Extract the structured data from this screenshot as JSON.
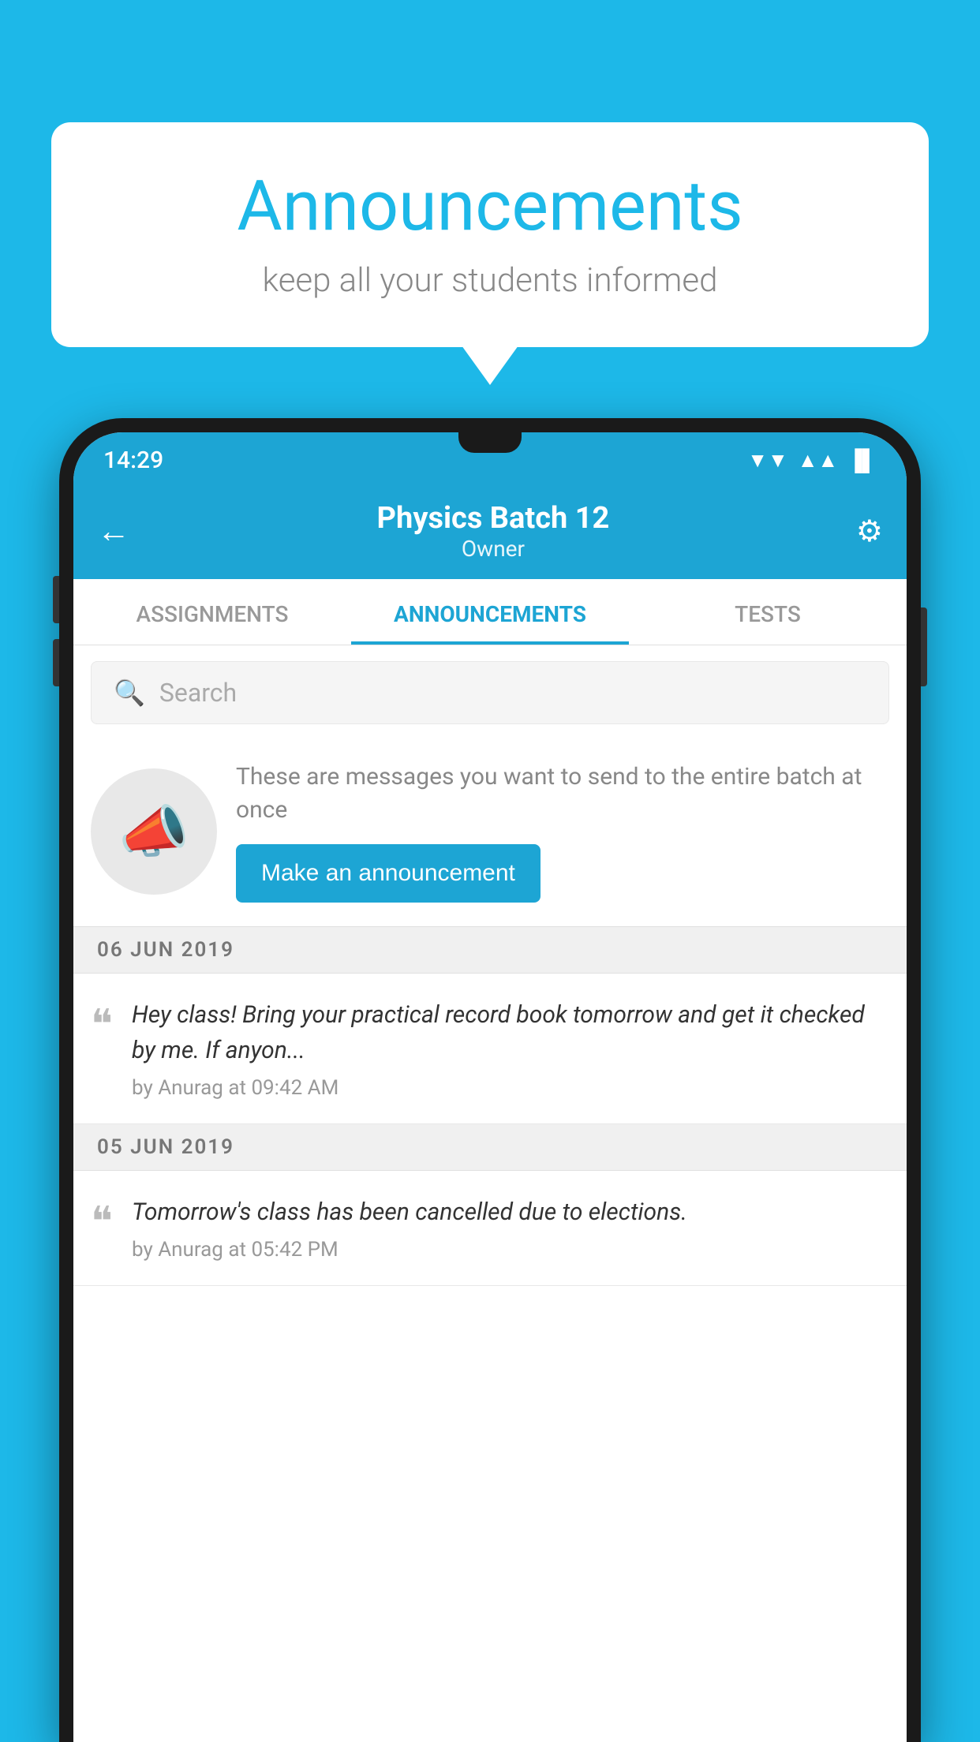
{
  "background_color": "#1DB8E8",
  "bubble": {
    "title": "Announcements",
    "subtitle": "keep all your students informed"
  },
  "phone": {
    "status_bar": {
      "time": "14:29",
      "wifi": "▲",
      "signal": "▲",
      "battery": "▐"
    },
    "app_bar": {
      "title": "Physics Batch 12",
      "subtitle": "Owner",
      "back_icon": "←",
      "settings_icon": "⚙"
    },
    "tabs": [
      {
        "label": "ASSIGNMENTS",
        "active": false
      },
      {
        "label": "ANNOUNCEMENTS",
        "active": true
      },
      {
        "label": "TESTS",
        "active": false
      }
    ],
    "search": {
      "placeholder": "Search"
    },
    "empty_state": {
      "description": "These are messages you want to send to the entire batch at once",
      "button_label": "Make an announcement"
    },
    "date_sections": [
      {
        "date": "06  JUN  2019",
        "items": [
          {
            "text": "Hey class! Bring your practical record book tomorrow and get it checked by me. If anyon...",
            "meta": "by Anurag at 09:42 AM"
          }
        ]
      },
      {
        "date": "05  JUN  2019",
        "items": [
          {
            "text": "Tomorrow's class has been cancelled due to elections.",
            "meta": "by Anurag at 05:42 PM"
          }
        ]
      }
    ]
  }
}
